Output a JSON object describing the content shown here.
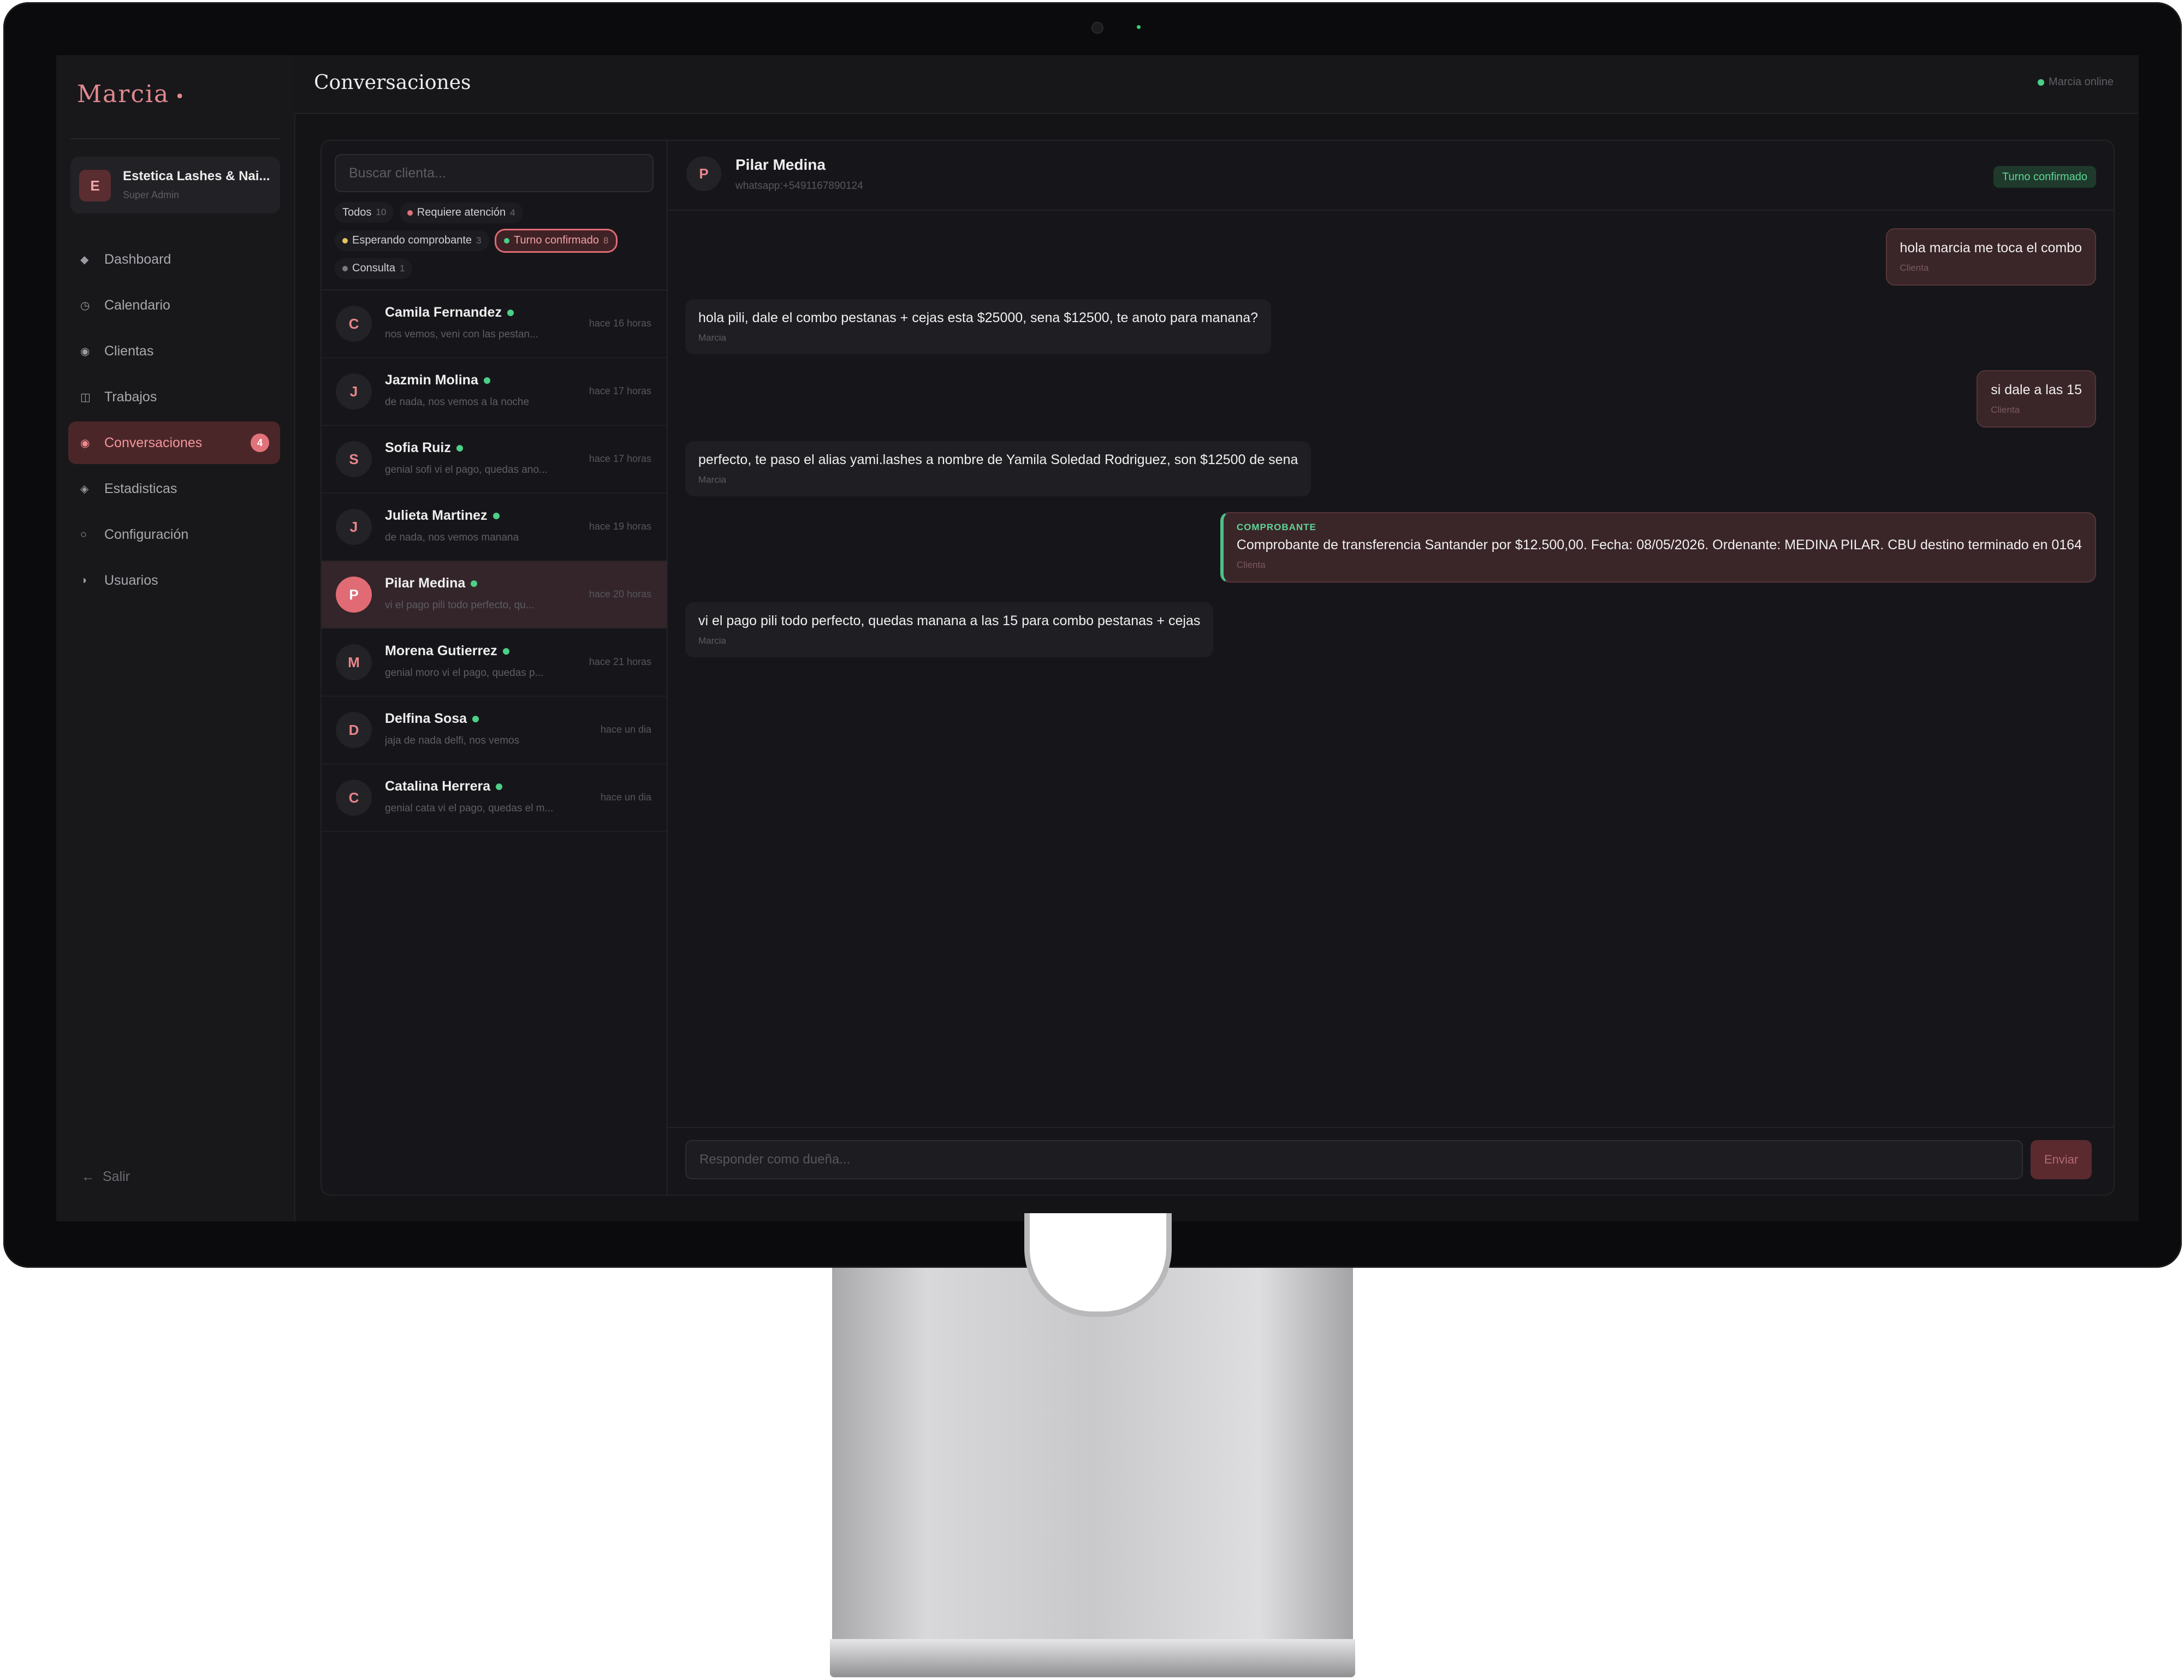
{
  "brand": {
    "name": "Marcia",
    "dot": "•"
  },
  "org": {
    "initial": "E",
    "name": "Estetica Lashes & Nai...",
    "role": "Super Admin"
  },
  "nav": [
    {
      "icon": "diamond-icon",
      "glyph": "◆",
      "label": "Dashboard"
    },
    {
      "icon": "clock-icon",
      "glyph": "◷",
      "label": "Calendario"
    },
    {
      "icon": "user-circle-icon",
      "glyph": "◉",
      "label": "Clientas"
    },
    {
      "icon": "grid-icon",
      "glyph": "◫",
      "label": "Trabajos"
    },
    {
      "icon": "chat-icon",
      "glyph": "◉",
      "label": "Conversaciones",
      "badge": "4",
      "active": true
    },
    {
      "icon": "chart-icon",
      "glyph": "◈",
      "label": "Estadisticas"
    },
    {
      "icon": "gear-icon",
      "glyph": "○",
      "label": "Configuración"
    },
    {
      "icon": "users-icon",
      "glyph": "◑",
      "label": "Usuarios"
    }
  ],
  "logout": {
    "arrow": "←",
    "label": "Salir"
  },
  "header": {
    "title": "Conversaciones",
    "status": "Marcia online"
  },
  "search": {
    "placeholder": "Buscar clienta..."
  },
  "filters": [
    {
      "label": "Todos",
      "count": "10",
      "dot": ""
    },
    {
      "label": "Requiere atención",
      "count": "4",
      "dot": "#e2727a"
    },
    {
      "label": "Esperando comprobante",
      "count": "3",
      "dot": "#e8c25a"
    },
    {
      "label": "Turno confirmado",
      "count": "8",
      "dot": "#4ccf86",
      "active": true
    },
    {
      "label": "Consulta",
      "count": "1",
      "dot": "#7a7a80"
    }
  ],
  "conversations": [
    {
      "initial": "C",
      "name": "Camila Fernandez",
      "preview": "nos vemos, veni con las pestan...",
      "time": "hace 16 horas"
    },
    {
      "initial": "J",
      "name": "Jazmin Molina",
      "preview": "de nada, nos vemos a la noche",
      "time": "hace 17 horas"
    },
    {
      "initial": "S",
      "name": "Sofia Ruiz",
      "preview": "genial sofi vi el pago, quedas ano...",
      "time": "hace 17 horas"
    },
    {
      "initial": "J",
      "name": "Julieta Martinez",
      "preview": "de nada, nos vemos manana",
      "time": "hace 19 horas"
    },
    {
      "initial": "P",
      "name": "Pilar Medina",
      "preview": "vi el pago pili todo perfecto, qu...",
      "time": "hace 20 horas",
      "active": true
    },
    {
      "initial": "M",
      "name": "Morena Gutierrez",
      "preview": "genial moro vi el pago, quedas p...",
      "time": "hace 21 horas"
    },
    {
      "initial": "D",
      "name": "Delfina Sosa",
      "preview": "jaja de nada delfi, nos vemos",
      "time": "hace un dia"
    },
    {
      "initial": "C",
      "name": "Catalina Herrera",
      "preview": "genial cata vi el pago, quedas el m...",
      "time": "hace un dia"
    }
  ],
  "chat": {
    "initial": "P",
    "name": "Pilar Medina",
    "sub": "whatsapp:+5491167890124",
    "badge": "Turno confirmado",
    "messages": [
      {
        "dir": "out",
        "text": "hola marcia me toca el combo",
        "author": "Clienta"
      },
      {
        "dir": "in",
        "text": "hola pili, dale el combo pestanas + cejas esta $25000, sena $12500, te anoto para manana?",
        "author": "Marcia"
      },
      {
        "dir": "out",
        "text": "si dale a las 15",
        "author": "Clienta"
      },
      {
        "dir": "in",
        "text": "perfecto, te paso el alias yami.lashes a nombre de Yamila Soledad Rodriguez, son $12500 de sena",
        "author": "Marcia"
      },
      {
        "dir": "out",
        "kicker": "COMPROBANTE",
        "text": "Comprobante de transferencia Santander por $12.500,00. Fecha: 08/05/2026. Ordenante: MEDINA PILAR. CBU destino terminado en 0164",
        "author": "Clienta"
      },
      {
        "dir": "in",
        "text": "vi el pago pili todo perfecto, quedas manana a las 15 para combo pestanas + cejas",
        "author": "Marcia"
      }
    ]
  },
  "composer": {
    "placeholder": "Responder como dueña...",
    "send": "Enviar"
  }
}
